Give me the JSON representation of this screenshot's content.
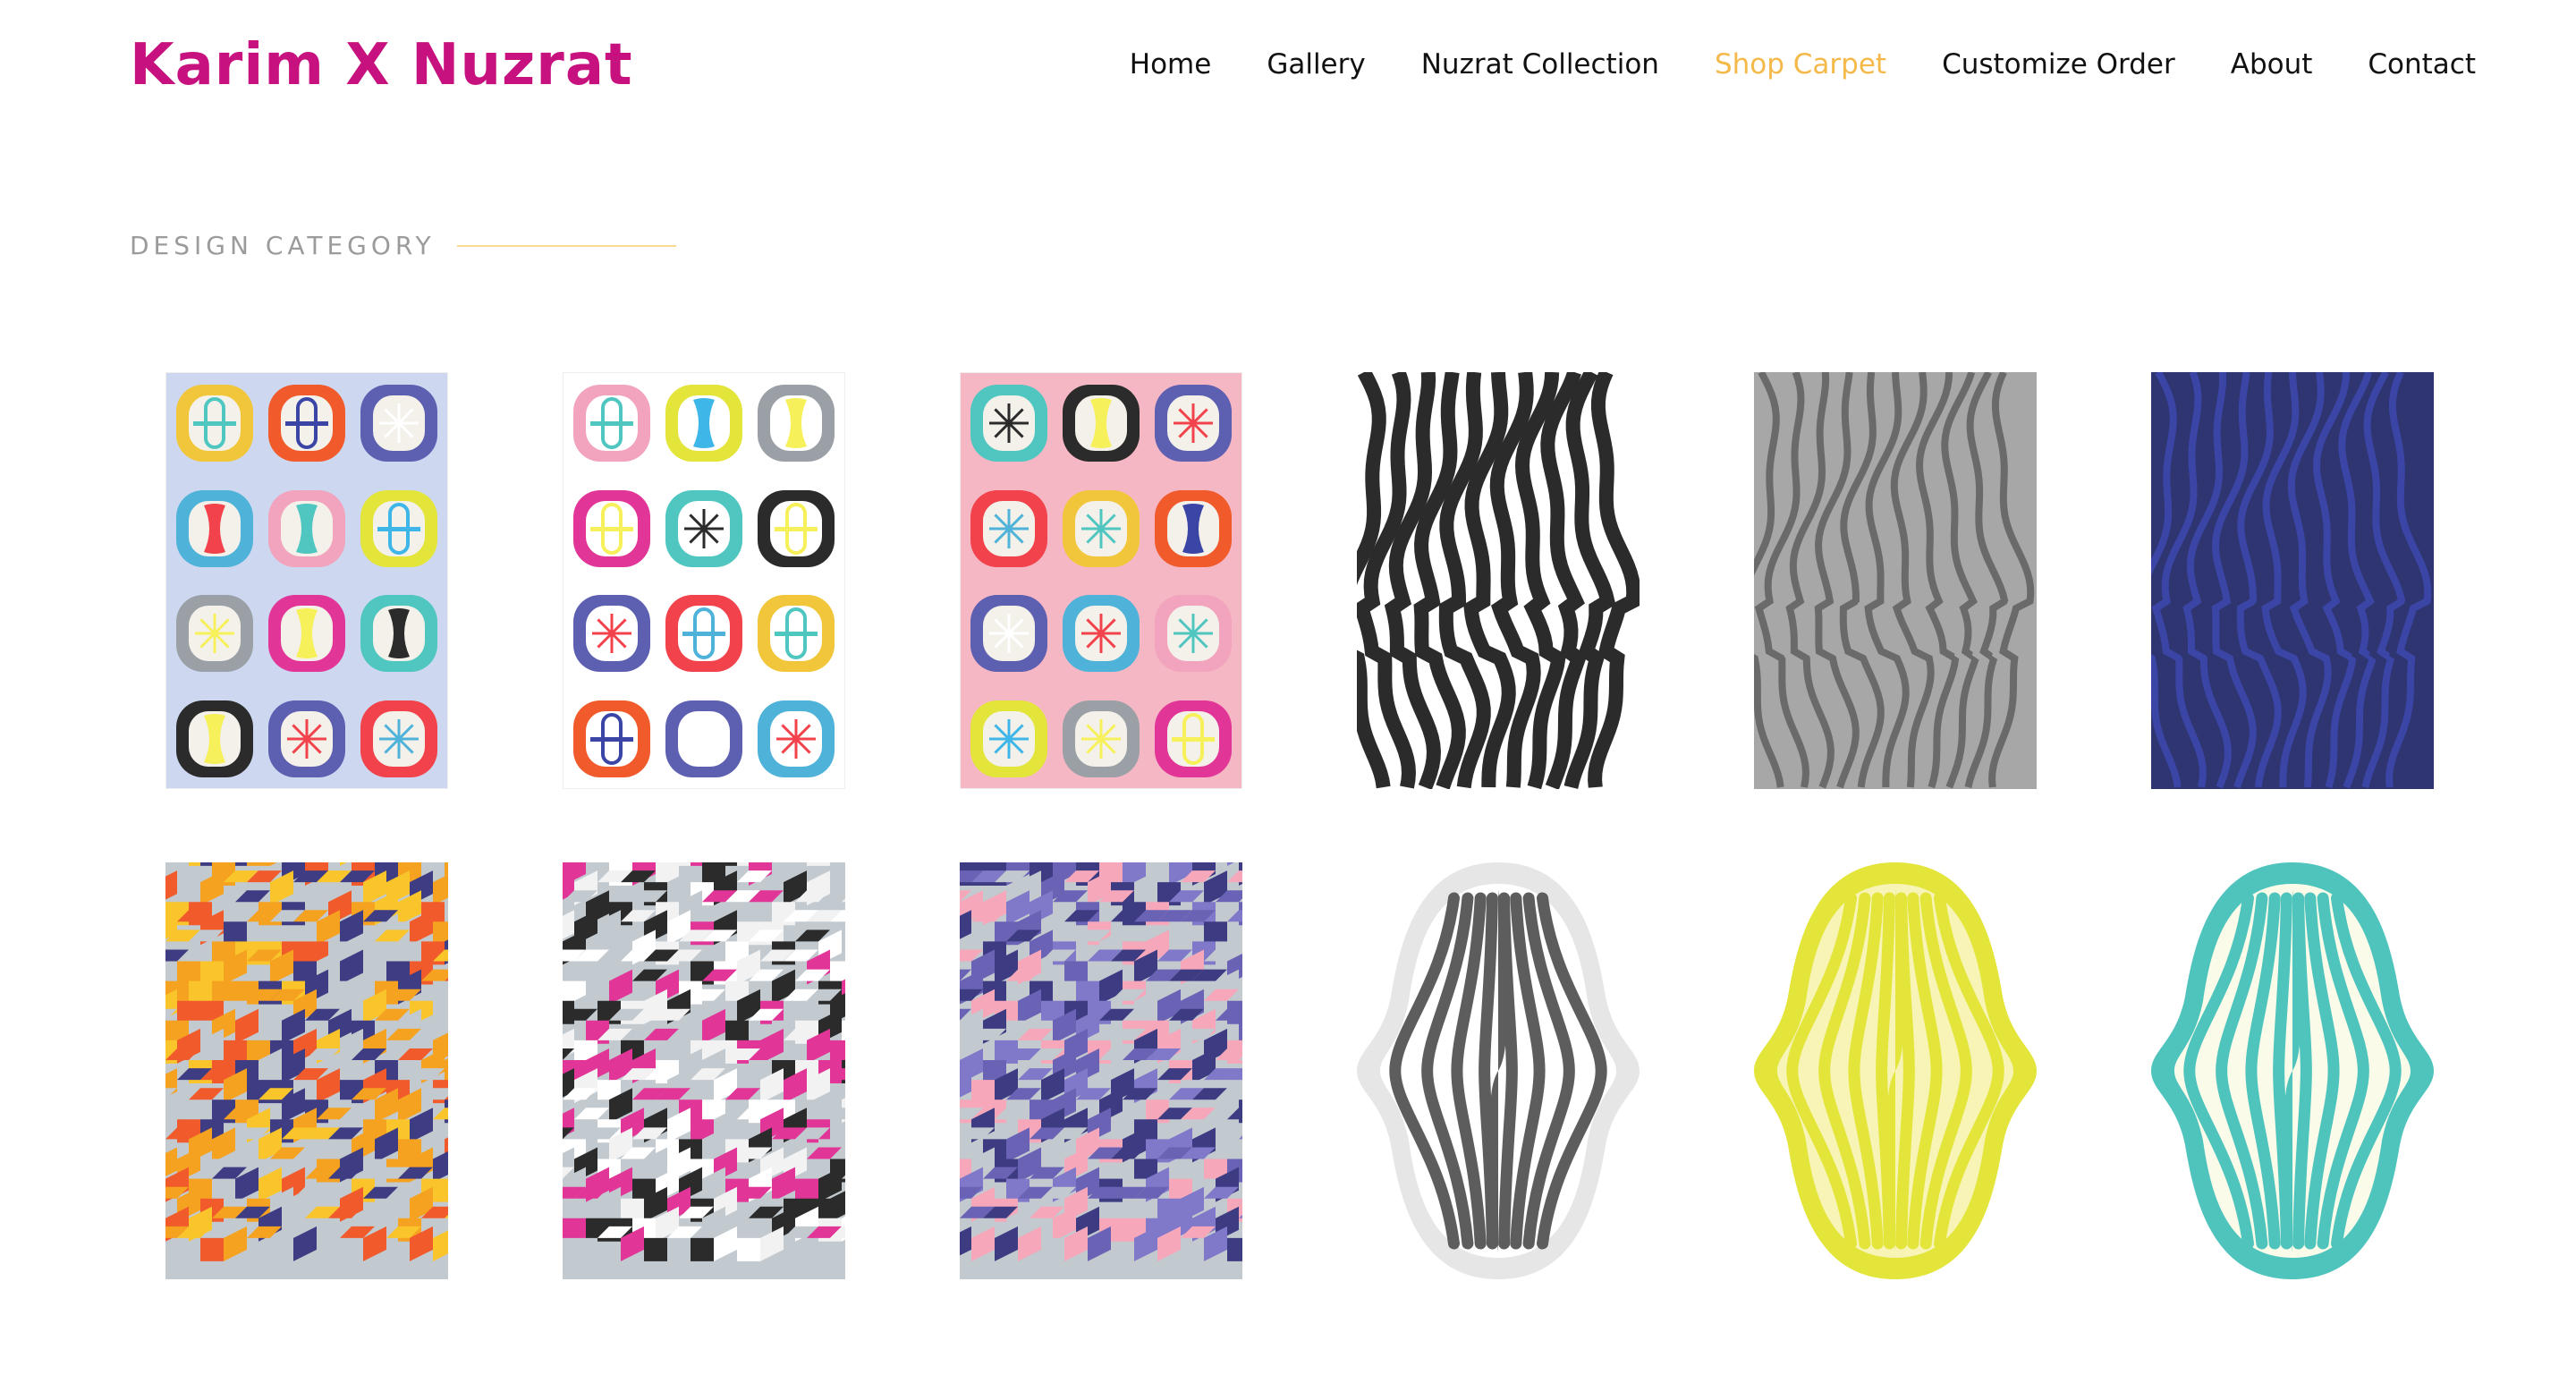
{
  "site": {
    "brand": "Karim X Nuzrat"
  },
  "nav": {
    "items": [
      {
        "label": "Home",
        "active": false
      },
      {
        "label": "Gallery",
        "active": false
      },
      {
        "label": "Nuzrat Collection",
        "active": false
      },
      {
        "label": "Shop Carpet",
        "active": true
      },
      {
        "label": "Customize Order",
        "active": false
      },
      {
        "label": "About",
        "active": false
      },
      {
        "label": "Contact",
        "active": false
      }
    ]
  },
  "section": {
    "title": "DESIGN CATEGORY"
  },
  "colors": {
    "brand": "#c7117f",
    "nav_active": "#f5b94a",
    "section_title": "#9b9b9b",
    "section_rule": "#f7d98f"
  },
  "gallery": {
    "tiles": [
      {
        "name": "pill-pattern-periwinkle-carpet",
        "design": "pills",
        "bg": "#cdd8f0"
      },
      {
        "name": "pill-pattern-white-carpet",
        "design": "pills",
        "bg": "#ffffff"
      },
      {
        "name": "pill-pattern-pink-carpet",
        "design": "pills",
        "bg": "#f6b7c4"
      },
      {
        "name": "wave-stripe-black-carpet",
        "design": "waves",
        "ink": "#2b2b2b"
      },
      {
        "name": "wave-stripe-grey-carpet",
        "design": "waves",
        "ink": "#a7a7a7",
        "inner": "#6a6a6a"
      },
      {
        "name": "wave-stripe-navy-carpet",
        "design": "waves",
        "ink": "#2e3570",
        "inner": "#3b45a6"
      },
      {
        "name": "isometric-yellow-navy-carpet",
        "design": "iso",
        "palette": [
          "#f9c52a",
          "#f15a2b",
          "#3e3c82",
          "#c2c9cf",
          "#f6a221"
        ]
      },
      {
        "name": "isometric-magenta-black-carpet",
        "design": "iso",
        "palette": [
          "#e13597",
          "#2b2b2b",
          "#ffffff",
          "#c2c9cf",
          "#f2f2f2"
        ]
      },
      {
        "name": "isometric-purple-pink-carpet",
        "design": "iso",
        "palette": [
          "#6a63b5",
          "#f6a7ba",
          "#3d3c82",
          "#c2c9cf",
          "#8078c8"
        ]
      },
      {
        "name": "organic-stripe-grey-carpet",
        "design": "organic",
        "ring": "#e6e6e6",
        "stripe": "#5d5d5d",
        "gap": "#ffffff"
      },
      {
        "name": "organic-stripe-lime-carpet",
        "design": "organic",
        "ring": "#e3e53a",
        "stripe": "#e3e53a",
        "gap": "#f7f4b6"
      },
      {
        "name": "organic-stripe-teal-carpet",
        "design": "organic",
        "ring": "#4fc4bd",
        "stripe": "#4fc4bd",
        "gap": "#fbfbea"
      }
    ]
  }
}
